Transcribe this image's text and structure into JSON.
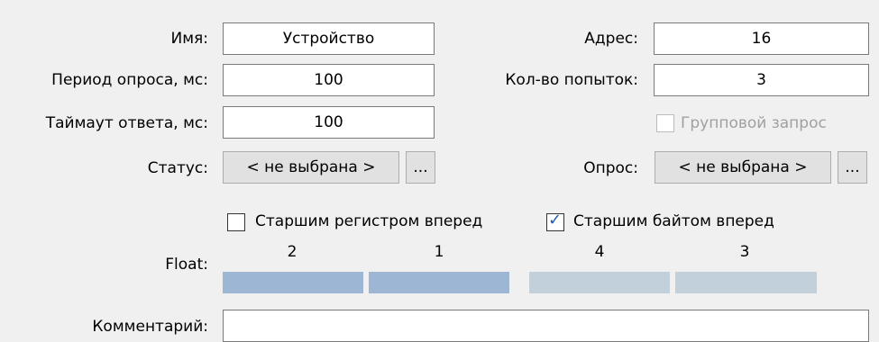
{
  "fields": {
    "name_label": "Имя:",
    "name_value": "Устройство",
    "address_label": "Адрес:",
    "address_value": "16",
    "period_label": "Период опроса, мс:",
    "period_value": "100",
    "attempts_label": "Кол-во попыток:",
    "attempts_value": "3",
    "timeout_label": "Таймаут ответа, мс:",
    "timeout_value": "100",
    "group_request_label": "Групповой запрос",
    "status_label": "Статус:",
    "status_value": "< не выбрана >",
    "status_browse": "...",
    "poll_label": "Опрос:",
    "poll_value": "< не выбрана >",
    "poll_browse": "..."
  },
  "float": {
    "label": "Float:",
    "high_register_first_label": "Старшим регистром вперед",
    "high_register_first_checked": false,
    "high_byte_first_label": "Старшим байтом вперед",
    "high_byte_first_checked": true,
    "byte_order": [
      "2",
      "1",
      "4",
      "3"
    ]
  },
  "comment": {
    "label": "Комментарий:",
    "value": ""
  },
  "colors": {
    "segment_active": "#9cb6d3",
    "segment_inactive": "#c2d0dc",
    "checkmark": "#1a5fb4"
  }
}
